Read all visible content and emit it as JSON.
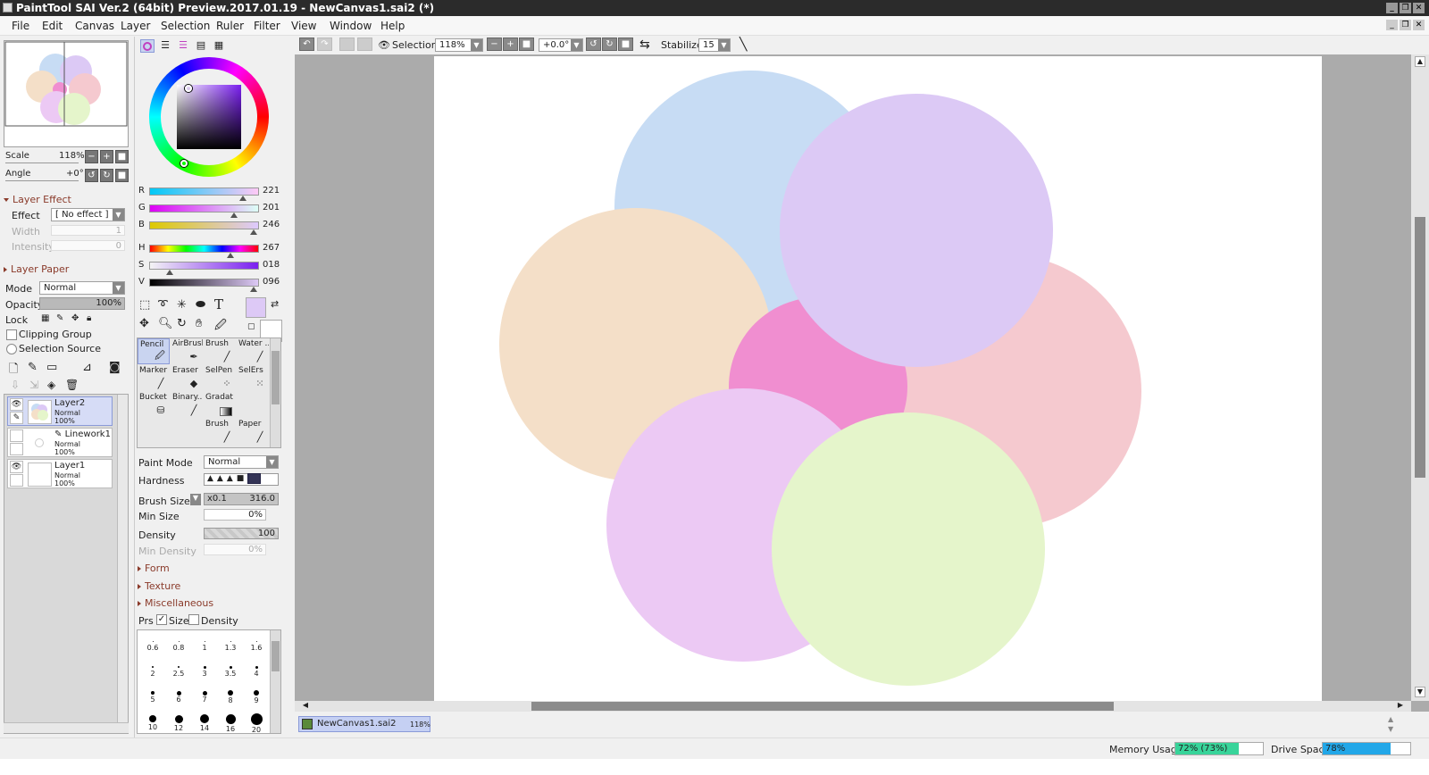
{
  "window": {
    "title": "PaintTool SAI Ver.2 (64bit) Preview.2017.01.19 - NewCanvas1.sai2 (*)"
  },
  "menu": [
    "File",
    "Edit",
    "Canvas",
    "Layer",
    "Selection",
    "Ruler",
    "Filter",
    "View",
    "Window",
    "Help"
  ],
  "navigator": {
    "scale_label": "Scale",
    "scale_value": "118%",
    "angle_label": "Angle",
    "angle_value": "+0°"
  },
  "layer_effect": {
    "title": "Layer Effect",
    "effect_label": "Effect",
    "effect_value": "[ No effect ]",
    "width_label": "Width",
    "width_value": "1",
    "intensity_label": "Intensity",
    "intensity_value": "0"
  },
  "layer_paper": {
    "title": "Layer Paper"
  },
  "layer_props": {
    "mode_label": "Mode",
    "mode_value": "Normal",
    "opacity_label": "Opacity",
    "opacity_value": "100%",
    "lock_label": "Lock",
    "clipping_group": "Clipping Group",
    "selection_source": "Selection Source"
  },
  "layers": [
    {
      "name": "Layer2",
      "mode": "Normal",
      "opacity": "100%",
      "selected": true
    },
    {
      "name": "Linework1",
      "mode": "Normal",
      "opacity": "100%",
      "selected": false
    },
    {
      "name": "Layer1",
      "mode": "Normal",
      "opacity": "100%",
      "selected": false
    }
  ],
  "color": {
    "r_label": "R",
    "r_value": "221",
    "g_label": "G",
    "g_value": "201",
    "b_label": "B",
    "b_value": "246",
    "h_label": "H",
    "h_value": "267",
    "s_label": "S",
    "s_value": "018",
    "v_label": "V",
    "v_value": "096",
    "current": "#ddc9f6"
  },
  "tools": [
    {
      "label": "Pencil",
      "icon": "pencil-icon"
    },
    {
      "label": "AirBrush",
      "icon": "airbrush-icon"
    },
    {
      "label": "Brush",
      "icon": "brush-icon"
    },
    {
      "label": "Water ...",
      "icon": "water-icon"
    },
    {
      "label": "Marker",
      "icon": "marker-icon"
    },
    {
      "label": "Eraser",
      "icon": "eraser-icon"
    },
    {
      "label": "SelPen",
      "icon": "selpen-icon"
    },
    {
      "label": "SelErs",
      "icon": "selers-icon"
    },
    {
      "label": "Bucket",
      "icon": "bucket-icon"
    },
    {
      "label": "Binary...",
      "icon": "binary-icon"
    },
    {
      "label": "Gradat",
      "icon": "gradation-icon"
    },
    {
      "label": "Brush",
      "icon": "brush-icon"
    },
    {
      "label": "Paper",
      "icon": "paper-icon"
    }
  ],
  "brush_settings": {
    "paint_mode_label": "Paint Mode",
    "paint_mode_value": "Normal",
    "hardness_label": "Hardness",
    "brush_size_label": "Brush Size",
    "brush_size_mult": "x0.1",
    "brush_size_value": "316.0",
    "min_size_label": "Min Size",
    "min_size_value": "0%",
    "density_label": "Density",
    "density_value": "100",
    "min_density_label": "Min Density",
    "min_density_value": "0%",
    "form": "Form",
    "texture": "Texture",
    "misc": "Miscellaneous",
    "prs_label": "Prs",
    "prs_size": "Size",
    "prs_density": "Density"
  },
  "brush_sizes": [
    "0.6",
    "0.8",
    "1",
    "1.3",
    "1.6",
    "2",
    "2.5",
    "3",
    "3.5",
    "4",
    "5",
    "6",
    "7",
    "8",
    "9",
    "10",
    "12",
    "14",
    "16",
    "20"
  ],
  "toolbar": {
    "selection_label": "Selection",
    "zoom_value": "118%",
    "angle_value": "+0.0°",
    "stabilizer_label": "Stabilizer",
    "stabilizer_value": "15"
  },
  "document_tab": {
    "name": "NewCanvas1.sai2",
    "zoom": "118%"
  },
  "status": {
    "memory_label": "Memory Usage",
    "memory_value": "72% (73%)",
    "memory_fraction": 0.72,
    "drive_label": "Drive Space",
    "drive_value": "78%",
    "drive_fraction": 0.78
  },
  "canvas_circles": [
    "#c7dcf4",
    "#dcc9f5",
    "#f4dfc8",
    "#f5c9cf",
    "#f08ed0",
    "#ecc9f4",
    "#e5f5cb"
  ]
}
